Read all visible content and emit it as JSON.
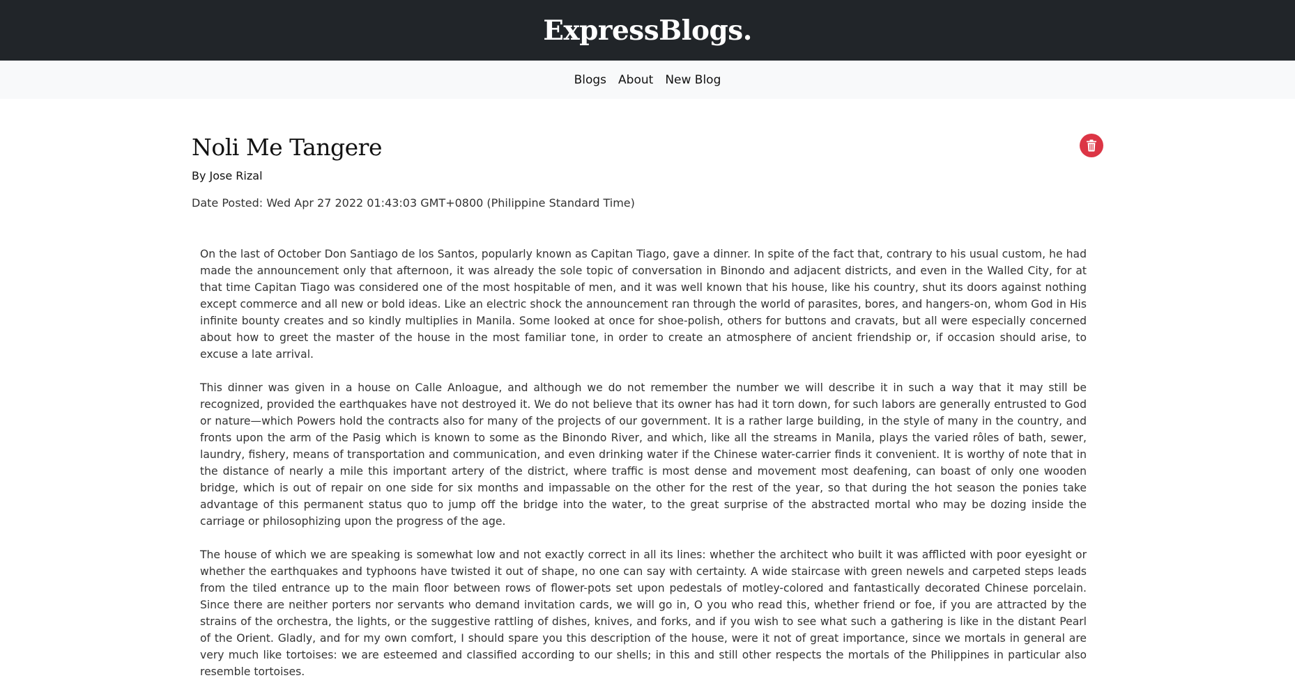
{
  "brand": {
    "title": "ExpressBlogs."
  },
  "nav": {
    "items": [
      {
        "label": "Blogs"
      },
      {
        "label": "About"
      },
      {
        "label": "New Blog"
      }
    ]
  },
  "post": {
    "title": "Noli Me Tangere",
    "author": "By Jose Rizal",
    "date": "Date Posted: Wed Apr 27 2022 01:43:03 GMT+0800 (Philippine Standard Time)",
    "delete_icon": "trash-icon",
    "paragraphs": [
      "On the last of October Don Santiago de los Santos, popularly known as Capitan Tiago, gave a dinner.  In spite of the fact that, contrary to his usual custom, he had made the announcement only that afternoon, it was already the sole topic of conversation in Binondo and adjacent districts, and even in the Walled City, for at that time Capitan Tiago was considered one of the most hospitable of men, and it was well known that his house, like his country, shut its doors against nothing except commerce and all new or bold ideas.  Like an electric shock the announcement ran through the world of parasites, bores, and hangers-on, whom God in His infinite bounty creates and so kindly multiplies in Manila.  Some looked at once for shoe-polish, others for buttons and cravats, but all were especially concerned about how to greet the master of the house in the most familiar tone, in order to create an atmosphere of ancient friendship or, if occasion should arise, to excuse a late arrival.",
      "This dinner was given in a house on Calle Anloague, and although we do not remember the number we will describe it in such a way that it may still be recognized, provided the earthquakes have not destroyed it.  We do not believe that its owner has had it torn down, for such labors are generally entrusted to God or nature—which Powers hold the contracts also for many of the projects of our government.  It is a rather large building, in the style of many in the country, and fronts upon the arm of the Pasig which is known to some as the Binondo River, and which, like all the streams in Manila, plays the varied rôles of bath, sewer, laundry, fishery, means of transportation and communication, and even drinking water if the Chinese water-carrier finds it convenient.  It is worthy of note that in the distance of nearly a mile this important artery of the district, where traffic is most dense and movement most deafening, can boast of only one wooden bridge, which is out of repair on one side for six months and impassable on the other for the rest of the year, so that during the hot season the ponies take advantage of this permanent status quo to jump off the bridge into the water, to the great surprise of the abstracted mortal who may be dozing inside the carriage or philosophizing upon the progress of the age.",
      "The house of which we are speaking is somewhat low and not exactly correct in all its lines: whether the architect who built it was afflicted with poor eyesight or whether the earthquakes and typhoons have twisted it out of shape, no one can say with certainty.  A wide staircase with green newels and carpeted steps leads from the tiled entrance up to the main floor between rows of flower-pots set upon pedestals of motley-colored and fantastically decorated Chinese porcelain.  Since there are neither porters nor servants who demand invitation cards, we will go in, O you who read this, whether friend or foe, if you are attracted by the strains of the orchestra, the lights, or the suggestive rattling of dishes, knives, and forks, and if you wish to see what such a gathering is like in the distant Pearl of the Orient.  Gladly, and for my own comfort, I should spare you this description of the house, were it not of great importance, since we mortals in general are very much like tortoises: we are esteemed and classified according to our shells; in this and still other respects the mortals of the Philippines in particular also resemble tortoises."
    ]
  },
  "colors": {
    "header_bg": "#212529",
    "nav_bg": "#f8f9fa",
    "delete_button": "#dc3545"
  }
}
